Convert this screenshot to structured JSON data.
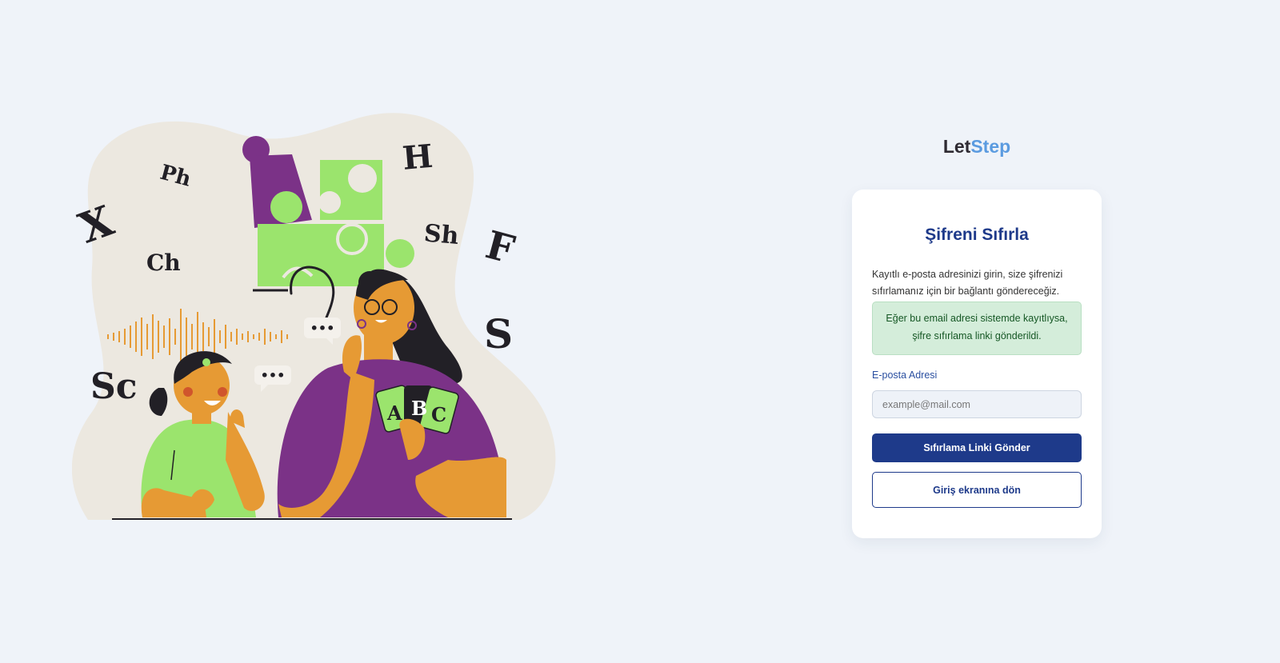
{
  "illustration": {
    "letters": [
      "X",
      "Ph",
      "Ch",
      "H",
      "Sh",
      "F",
      "S",
      "Sc"
    ],
    "cards": [
      "A",
      "B",
      "C"
    ],
    "bubble_dots": "•••",
    "colors": {
      "purple": "#7b3287",
      "green": "#9be46d",
      "orange": "#e69a34",
      "blob": "#ece8e0",
      "dark": "#222026"
    }
  },
  "brand": {
    "part1": "Let",
    "part2": "Step"
  },
  "card": {
    "title": "Şifreni Sıfırla",
    "description": "Kayıtlı e-posta adresinizi girin, size şifrenizi sıfırlamanız için bir bağlantı göndereceğiz.",
    "alert": "Eğer bu email adresi sistemde kayıtlıysa, şifre sıfırlama linki gönderildi.",
    "email_label": "E-posta Adresi",
    "email_placeholder": "example@mail.com",
    "email_value": "",
    "submit_label": "Sıfırlama Linki Gönder",
    "back_label": "Giriş ekranına dön"
  },
  "colors": {
    "accent": "#1e3a8a",
    "brand_blue": "#5b9be0",
    "alert_bg": "#d4edda",
    "alert_text": "#155724",
    "page_bg": "#eff3f9"
  }
}
